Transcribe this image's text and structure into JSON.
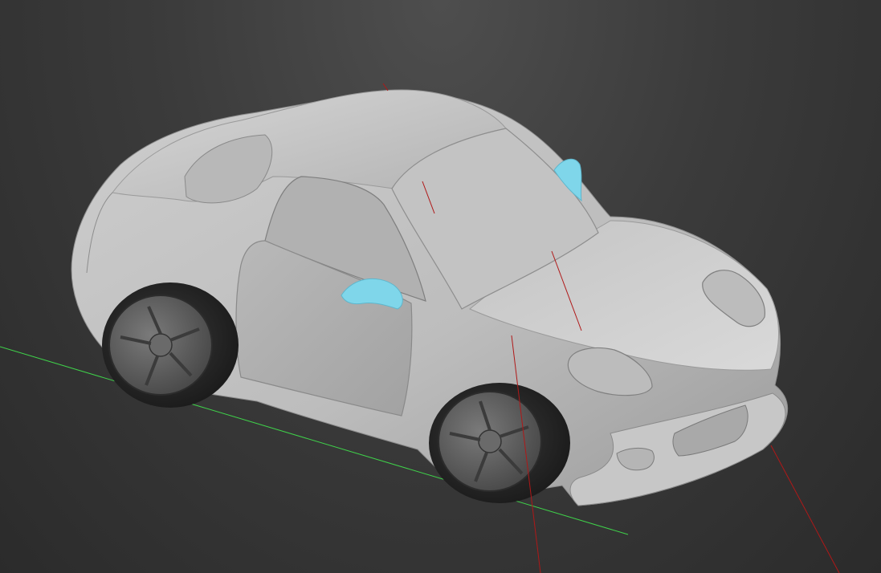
{
  "viewport": {
    "background": "#3a3a3a",
    "grid_axis_color": "#3fd24a",
    "axis_line_color": "#b01818",
    "model_color": "#c9c9c9",
    "mirror_color": "#7fd6ea",
    "tire_color": "#262626",
    "wheel_color": "#5a5a5a"
  },
  "scene": {
    "object": "car-model",
    "shading": "smooth"
  }
}
